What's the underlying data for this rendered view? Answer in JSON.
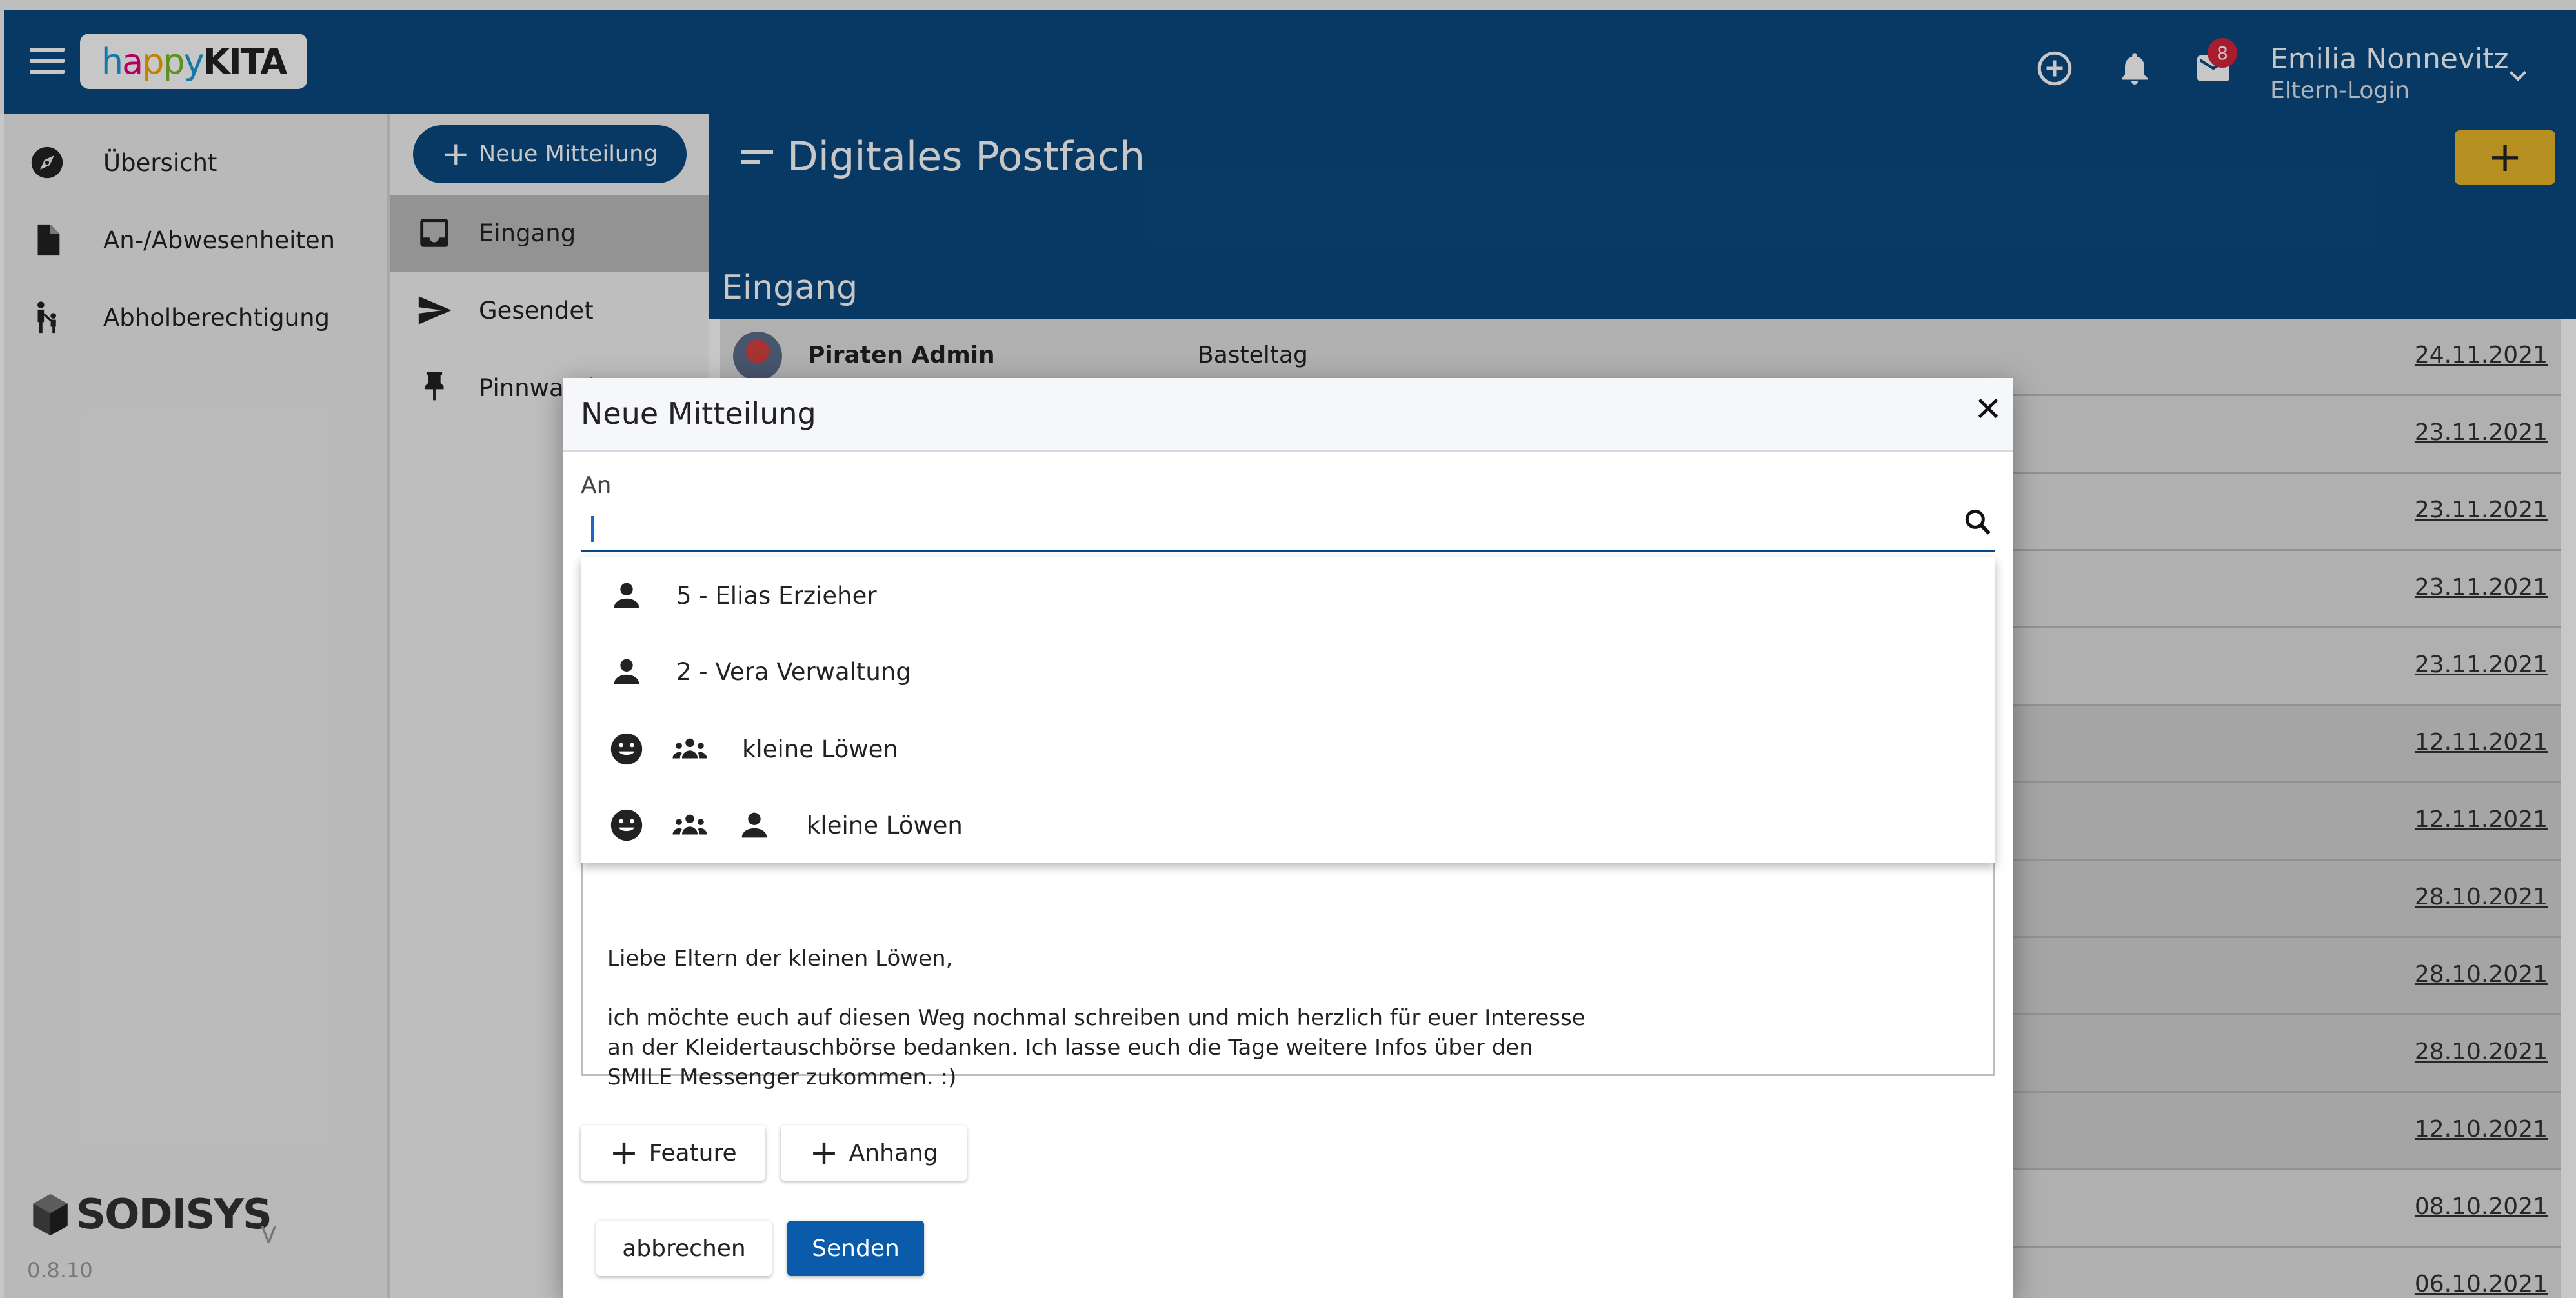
{
  "header": {
    "logo_text": "happyKITA",
    "mail_badge": "8",
    "user_name": "Emilia Nonnevitz",
    "user_role": "Eltern-Login"
  },
  "sidebar": {
    "items": [
      {
        "label": "Übersicht",
        "icon": "compass-icon"
      },
      {
        "label": "An-/Abwesenheiten",
        "icon": "document-icon"
      },
      {
        "label": "Abholberechtigung",
        "icon": "parent-child-icon"
      }
    ],
    "brand": "SODISYS",
    "v_tag": "V",
    "version": "0.8.10"
  },
  "mailbox": {
    "new_message_label": "Neue Mitteilung",
    "folders": [
      {
        "label": "Eingang",
        "icon": "inbox-icon"
      },
      {
        "label": "Gesendet",
        "icon": "send-icon"
      },
      {
        "label": "Pinnwand",
        "icon": "pin-icon"
      }
    ]
  },
  "main": {
    "title": "Digitales Postfach",
    "fab_label": "+",
    "section_title": "Eingang",
    "messages": [
      {
        "sender": "Piraten Admin",
        "subject": "Basteltag",
        "date": "24.11.2021"
      },
      {
        "sender": "",
        "subject": "",
        "date": "23.11.2021"
      },
      {
        "sender": "",
        "subject": "",
        "date": "23.11.2021"
      },
      {
        "sender": "",
        "subject": "",
        "date": "23.11.2021"
      },
      {
        "sender": "",
        "subject": "",
        "date": "23.11.2021"
      },
      {
        "sender": "",
        "subject": "",
        "date": "12.11.2021"
      },
      {
        "sender": "",
        "subject": "",
        "date": "12.11.2021"
      },
      {
        "sender": "",
        "subject": "",
        "date": "28.10.2021"
      },
      {
        "sender": "",
        "subject": "",
        "date": "28.10.2021"
      },
      {
        "sender": "",
        "subject": "",
        "date": "28.10.2021"
      },
      {
        "sender": "",
        "subject": "",
        "date": "12.10.2021"
      },
      {
        "sender": "",
        "subject": "",
        "date": "08.10.2021"
      },
      {
        "sender": "",
        "subject": "",
        "date": "06.10.2021"
      }
    ]
  },
  "dialog": {
    "title": "Neue Mitteilung",
    "to_label": "An",
    "to_value": "",
    "suggestions": [
      {
        "label": "5 - Elias Erzieher",
        "icons": [
          "person-icon"
        ]
      },
      {
        "label": "2 - Vera Verwaltung",
        "icons": [
          "person-icon"
        ]
      },
      {
        "label": "kleine Löwen",
        "icons": [
          "smiley-icon",
          "group-icon"
        ]
      },
      {
        "label": "kleine Löwen",
        "icons": [
          "smiley-icon",
          "group-icon",
          "person-icon"
        ]
      }
    ],
    "message_lines": {
      "greeting": "Liebe Eltern der kleinen Löwen,",
      "line1": "ich möchte euch auf diesen Weg nochmal schreiben und mich herzlich für euer Interesse",
      "line2": "an der Kleidertauschbörse bedanken. Ich lasse euch die Tage weitere Infos über den",
      "line3": "SMILE Messenger zukommen. :)"
    },
    "feature_label": "Feature",
    "attachment_label": "Anhang",
    "cancel_label": "abbrechen",
    "send_label": "Senden"
  }
}
